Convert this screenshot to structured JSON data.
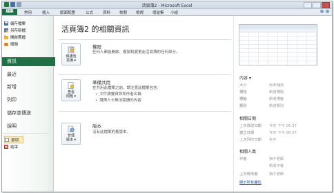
{
  "window": {
    "title": "活頁簿2 - Microsoft Excel"
  },
  "tabs": [
    "檔案",
    "常用",
    "插入",
    "版面配置",
    "公式",
    "資料",
    "校閱",
    "檢視",
    "增益集",
    "小組"
  ],
  "leftnav": {
    "commands": [
      "儲存檔案",
      "另存新檔",
      "開啟舊檔",
      "關閉"
    ],
    "items": [
      "資訊",
      "最近",
      "新增",
      "列印",
      "儲存並傳送",
      "說明"
    ],
    "bottom": [
      "選項",
      "結束"
    ]
  },
  "main": {
    "heading": "活頁簿2 的相關資訊",
    "sections": [
      {
        "title": "權限",
        "desc": "任何人都能開啟、複製和變更此活頁簿的任何部分。",
        "button": [
          "保護活",
          "頁簿 ▾"
        ]
      },
      {
        "title": "準備共用",
        "desc": "在共用此檔案之前，請注意此檔案包含:",
        "bullets": [
          "文件摘要資訊和作者名稱",
          "殘障人士無法閱讀的內容"
        ],
        "button": [
          "查看",
          "問題 ▾"
        ]
      },
      {
        "title": "版本",
        "desc": "沒有此檔案的舊版本。",
        "button": [
          "管理",
          "版本 ▾"
        ]
      }
    ]
  },
  "right": {
    "properties_header": "內容 ▾",
    "properties": [
      {
        "label": "大小",
        "value": "尚未儲存"
      },
      {
        "label": "標題",
        "value": "新增標題"
      },
      {
        "label": "標籤",
        "value": "新增標籤"
      },
      {
        "label": "類別",
        "value": "新增類別"
      }
    ],
    "dates_header": "相關日期",
    "dates": [
      {
        "label": "上次修改日期",
        "value": "今天 下午 06:37"
      },
      {
        "label": "建立日期",
        "value": "今天 下午 06:37"
      },
      {
        "label": "上次列印日期",
        "value": "永不"
      }
    ],
    "people_header": "相關人員",
    "people": [
      {
        "label": "作者",
        "value": "損子老師"
      },
      {
        "label": "",
        "value": "新增作者"
      },
      {
        "label": "上次修改者",
        "value": "損子老師"
      }
    ],
    "show_all": "顯示所有屬性"
  },
  "colors": {
    "file_green": "#1e7145",
    "accent_blue": "#2a5597",
    "select_yellow": "#fbe9b7"
  }
}
